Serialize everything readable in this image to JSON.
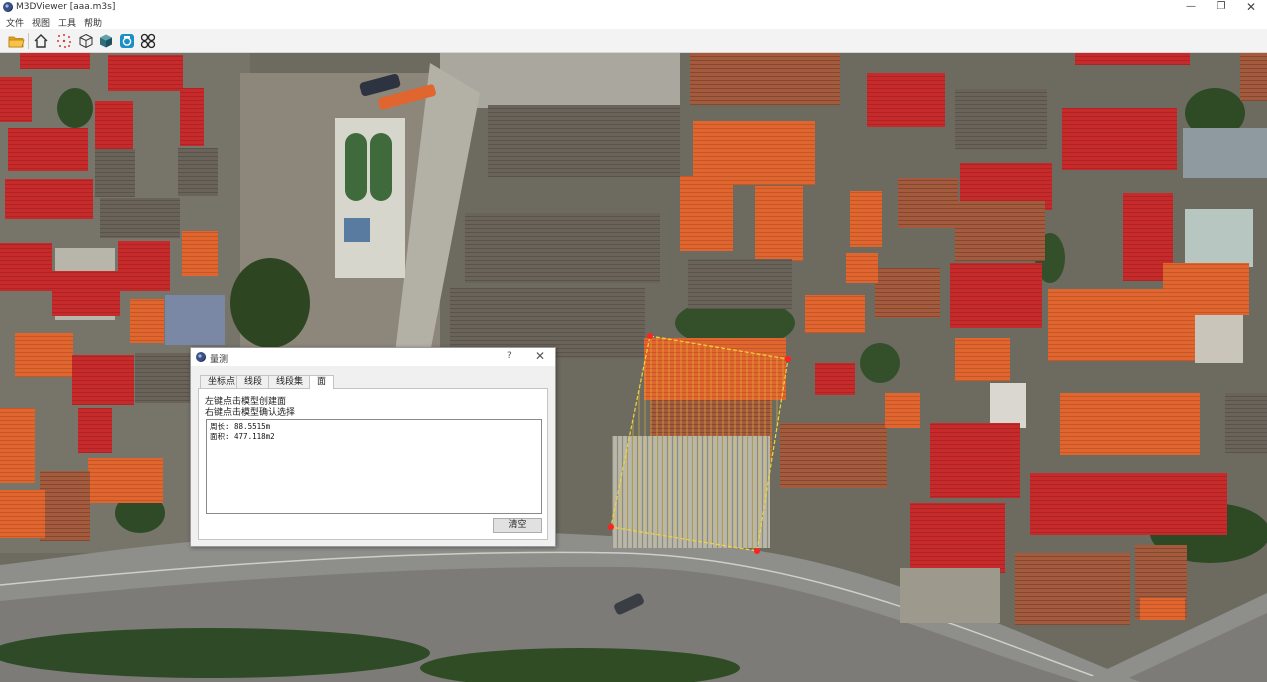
{
  "window": {
    "title": "M3DViewer [aaa.m3s]",
    "minimize_glyph": "—",
    "maximize_glyph": "❐",
    "close_glyph": "✕"
  },
  "menu": {
    "items": [
      "文件",
      "视图",
      "工具",
      "帮助"
    ]
  },
  "toolbar": {
    "icons": [
      "open-folder-icon",
      "home-icon",
      "point-cloud-icon",
      "wireframe-cube-icon",
      "textured-cube-icon",
      "camera-icon",
      "measure-tool-icon"
    ]
  },
  "dialog": {
    "title": "量测",
    "help_glyph": "?",
    "close_glyph": "✕",
    "tabs": [
      "坐标点",
      "线段",
      "线段集",
      "面"
    ],
    "active_tab": "面",
    "hints": [
      "左键点击模型创建面",
      "右键点击模型确认选择"
    ],
    "results": [
      "周长: 88.5515m",
      "面积: 477.118m2"
    ],
    "clear_label": "清空"
  },
  "colors": {
    "roof_red": "#c62a2a",
    "roof_orange": "#e0652e",
    "vertex_marker": "#ff2020",
    "polygon_outline": "#f2d43a",
    "road": "#8e8e8a"
  }
}
